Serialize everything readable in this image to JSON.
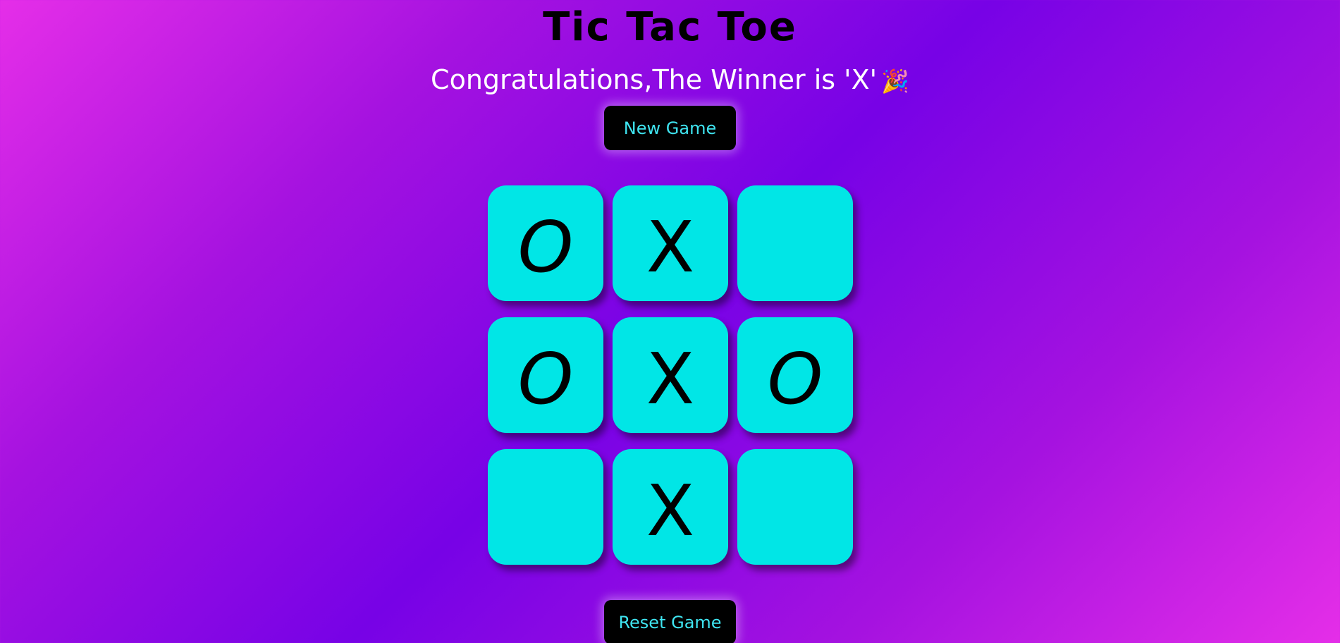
{
  "game": {
    "title": "Tic Tac Toe",
    "message": "Congratulations,The Winner is 'X'",
    "message_icon": "party-popper-icon",
    "new_game_label": "New Game",
    "reset_game_label": "Reset Game",
    "board": [
      [
        "O",
        "X",
        ""
      ],
      [
        "O",
        "X",
        "O"
      ],
      [
        "",
        "X",
        ""
      ]
    ]
  },
  "colors": {
    "cell": "#01e6e6",
    "button_bg": "#000000",
    "button_text": "#3fe4f0",
    "title": "#000000",
    "message": "#ffffff",
    "gradient_pink": "#e52ee8",
    "gradient_purple": "#7702e6"
  }
}
